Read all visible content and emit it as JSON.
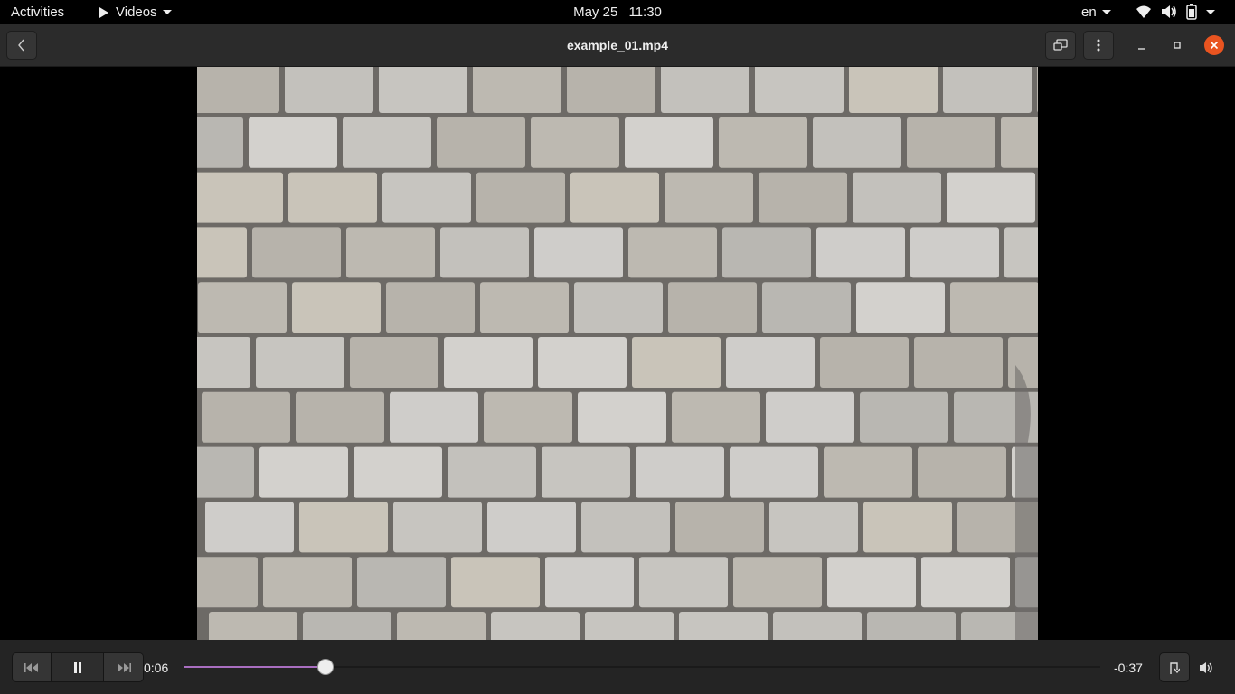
{
  "topbar": {
    "activities": "Activities",
    "app_name": "Videos",
    "date": "May 25",
    "time": "11:30",
    "language": "en",
    "status_icons": [
      "wifi-icon",
      "volume-icon",
      "battery-icon",
      "system-menu-caret-icon"
    ]
  },
  "window": {
    "title": "example_01.mp4",
    "buttons": [
      "back-icon",
      "picture-in-picture-icon",
      "more-menu-icon",
      "minimize-icon",
      "maximize-icon",
      "close-icon"
    ]
  },
  "player": {
    "elapsed": "0:06",
    "remaining": "-0:37",
    "progress_fraction": 0.154,
    "controls": [
      "previous-icon",
      "pause-icon",
      "next-icon",
      "rotate-icon",
      "volume-icon"
    ],
    "accent_color": "#a96ec0"
  },
  "video": {
    "content": "stone-paving-tiles"
  }
}
